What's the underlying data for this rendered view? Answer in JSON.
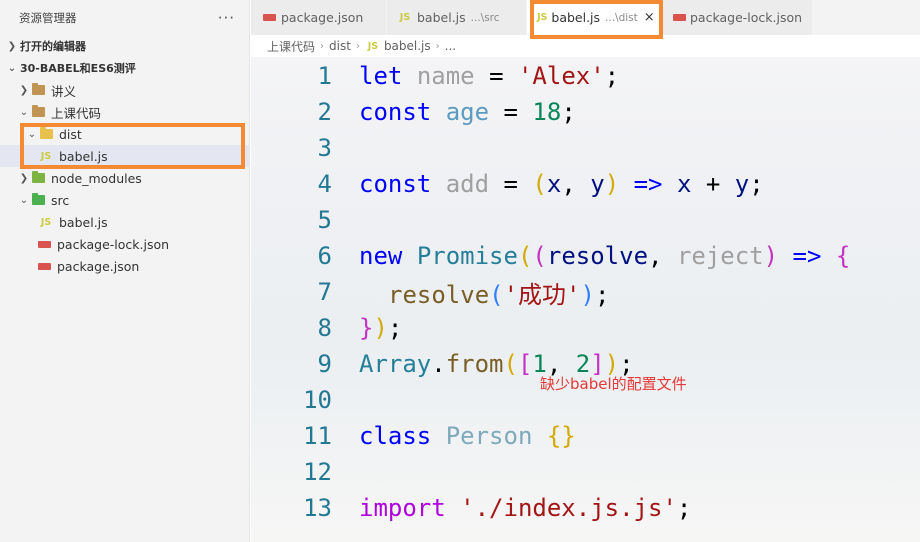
{
  "explorer": {
    "title": "资源管理器",
    "more": "···",
    "open_editors": "打开的编辑器",
    "root": "30-BABEL和ES6测评",
    "items": [
      {
        "label": "讲义",
        "type": "folder"
      },
      {
        "label": "上课代码",
        "type": "folder"
      },
      {
        "label": "dist",
        "type": "folder"
      },
      {
        "label": "babel.js",
        "type": "js"
      },
      {
        "label": "node_modules",
        "type": "folder"
      },
      {
        "label": "src",
        "type": "folder"
      },
      {
        "label": "babel.js",
        "type": "js"
      },
      {
        "label": "package-lock.json",
        "type": "json"
      },
      {
        "label": "package.json",
        "type": "json"
      }
    ]
  },
  "tabs": [
    {
      "label": "package.json",
      "desc": "",
      "icon": "json"
    },
    {
      "label": "babel.js",
      "desc": "...\\src",
      "icon": "JS"
    },
    {
      "label": "babel.js",
      "desc": "...\\dist",
      "icon": "JS",
      "close": "×"
    },
    {
      "label": "package-lock.json",
      "desc": "",
      "icon": "json"
    }
  ],
  "breadcrumb": [
    "上课代码",
    "dist",
    "JS",
    "babel.js",
    "..."
  ],
  "code": {
    "line_numbers": [
      "1",
      "2",
      "3",
      "4",
      "5",
      "6",
      "7",
      "8",
      "9",
      "10",
      "11",
      "12",
      "13"
    ],
    "l1": {
      "a": "let",
      "b": "name",
      "c": "=",
      "d": "'Alex'",
      "e": ";"
    },
    "l2": {
      "a": "const",
      "b": "age",
      "c": "=",
      "d": "18",
      "e": ";"
    },
    "l4": {
      "a": "const",
      "b": "add",
      "c": "=",
      "d": "(",
      "e": "x",
      "f": ",",
      "g": "y",
      "h": ")",
      "i": "=>",
      "j": "x",
      "k": "+",
      "l": "y",
      "m": ";"
    },
    "l6": {
      "a": "new",
      "b": "Promise",
      "c": "(",
      "d": "(",
      "e": "resolve",
      "f": ",",
      "g": "reject",
      "h": ")",
      "i": "=>",
      "j": "{"
    },
    "l7": {
      "a": "resolve",
      "b": "(",
      "c": "'成功'",
      "d": ")",
      "e": ";"
    },
    "l8": {
      "a": "}",
      "b": ")",
      "c": ";"
    },
    "l9": {
      "a": "Array",
      "b": ".",
      "c": "from",
      "d": "(",
      "e": "[",
      "f": "1",
      "g": ",",
      "h": "2",
      "i": "]",
      "j": ")",
      "k": ";"
    },
    "l11": {
      "a": "class",
      "b": "Person",
      "c": "{}"
    },
    "l13": {
      "a": "import",
      "b": "'./index.js.js'",
      "c": ";"
    }
  },
  "annotation": "缺少babel的配置文件",
  "colors": {
    "highlight": "#f48a33",
    "annotation": "#e53935"
  }
}
